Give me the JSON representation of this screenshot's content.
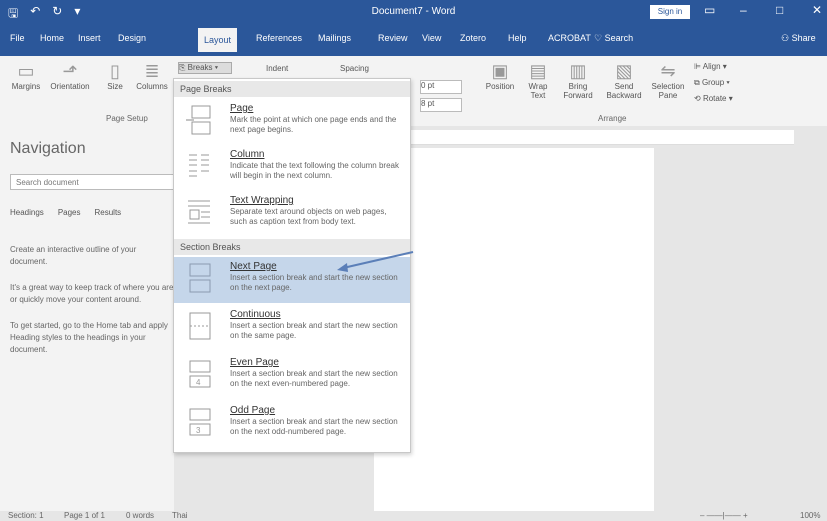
{
  "window": {
    "doc_title": "Document7 - Word",
    "sign_in": "Sign in"
  },
  "menu": {
    "tabs": [
      "File",
      "Home",
      "Insert",
      "Design",
      "Layout",
      "References",
      "Mailings",
      "Review",
      "View",
      "Zotero",
      "Help",
      "ACROBAT"
    ],
    "active_tab": "Layout",
    "search": "Search",
    "share": "Share"
  },
  "ribbon": {
    "margins": "Margins",
    "orientation": "Orientation",
    "size": "Size",
    "columns": "Columns",
    "breaks": "Breaks ▾",
    "indent": "Indent",
    "spacing": "Spacing",
    "indent_value": "0 pt",
    "spacing_value": "8 pt",
    "position": "Position",
    "wrap_text": "Wrap Text",
    "bring_forward": "Bring Forward",
    "send_backward": "Send Backward",
    "selection_pane": "Selection Pane",
    "align": "Align ▾",
    "group": "Group ▾",
    "rotate": "Rotate ▾",
    "page_setup_label": "Page Setup",
    "arrange_label": "Arrange"
  },
  "nav": {
    "title": "Navigation",
    "search_placeholder": "Search document",
    "tabs": [
      "Headings",
      "Pages",
      "Results"
    ],
    "text1": "Create an interactive outline of your document.",
    "text2": "It's a great way to keep track of where you are or quickly move your content around.",
    "text3": "To get started, go to the Home tab and apply Heading styles to the headings in your document."
  },
  "dropdown": {
    "page_breaks_header": "Page Breaks",
    "section_breaks_header": "Section Breaks",
    "items": [
      {
        "title": "Page",
        "desc": "Mark the point at which one page ends and the next page begins."
      },
      {
        "title": "Column",
        "desc": "Indicate that the text following the column break will begin in the next column."
      },
      {
        "title": "Text Wrapping",
        "desc": "Separate text around objects on web pages, such as caption text from body text."
      },
      {
        "title": "Next Page",
        "desc": "Insert a section break and start the new section on the next page."
      },
      {
        "title": "Continuous",
        "desc": "Insert a section break and start the new section on the same page."
      },
      {
        "title": "Even Page",
        "desc": "Insert a section break and start the new section on the next even-numbered page."
      },
      {
        "title": "Odd Page",
        "desc": "Insert a section break and start the new section on the next odd-numbered page."
      }
    ]
  },
  "status": {
    "section": "Section: 1",
    "page": "Page 1 of 1",
    "words": "0 words",
    "language": "Thai",
    "zoom": "100%"
  }
}
